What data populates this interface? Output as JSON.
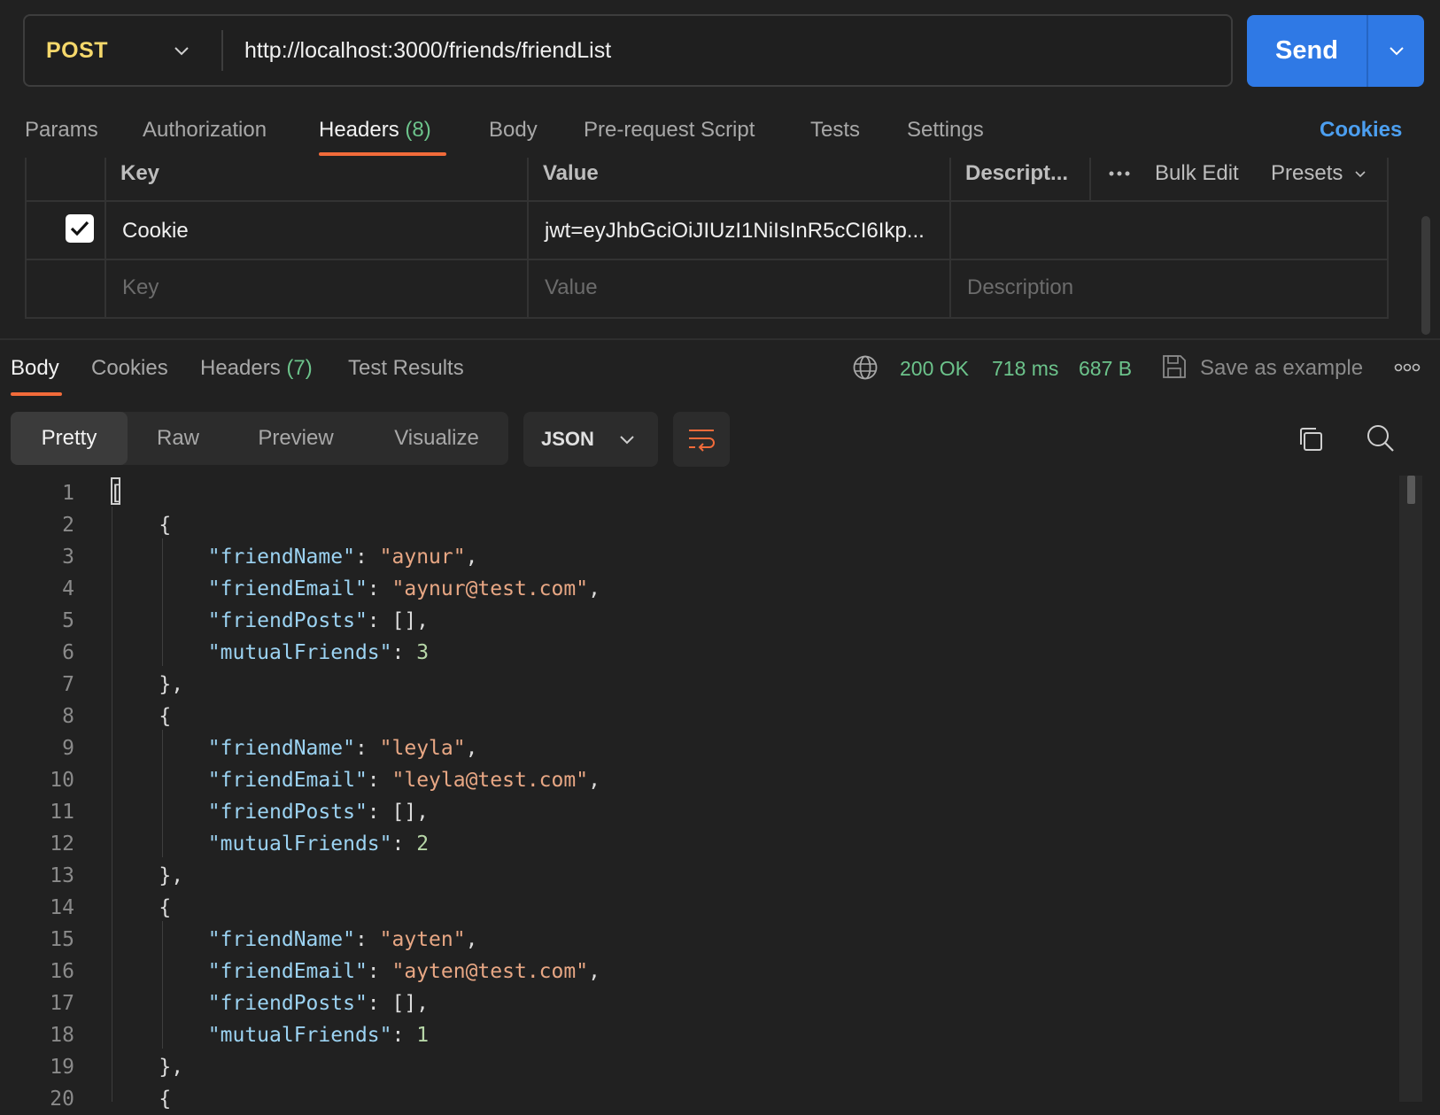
{
  "request": {
    "method": "POST",
    "url": "http://localhost:3000/friends/friendList",
    "send_label": "Send"
  },
  "request_tabs": [
    {
      "label": "Params"
    },
    {
      "label": "Authorization"
    },
    {
      "label": "Headers",
      "count": "(8)"
    },
    {
      "label": "Body"
    },
    {
      "label": "Pre-request Script"
    },
    {
      "label": "Tests"
    },
    {
      "label": "Settings"
    }
  ],
  "cookies_link": "Cookies",
  "headers_table": {
    "columns": {
      "key": "Key",
      "value": "Value",
      "description": "Descript..."
    },
    "actions": {
      "bulk_edit": "Bulk Edit",
      "presets": "Presets"
    },
    "rows": [
      {
        "checked": true,
        "key": "Cookie",
        "value": "jwt=eyJhbGciOiJIUzI1NiIsInR5cCI6Ikp..."
      }
    ],
    "placeholder": {
      "key": "Key",
      "value": "Value",
      "description": "Description"
    }
  },
  "response_tabs": [
    {
      "label": "Body"
    },
    {
      "label": "Cookies"
    },
    {
      "label": "Headers",
      "count": "(7)"
    },
    {
      "label": "Test Results"
    }
  ],
  "response_status": {
    "status": "200 OK",
    "time": "718 ms",
    "size": "687 B",
    "save_example": "Save as example"
  },
  "view_tabs": [
    "Pretty",
    "Raw",
    "Preview",
    "Visualize"
  ],
  "format": "JSON",
  "code_lines": [
    [
      [
        "p",
        "["
      ]
    ],
    [
      [
        "p",
        "    {"
      ]
    ],
    [
      [
        "p",
        "        "
      ],
      [
        "k",
        "\"friendName\""
      ],
      [
        "p",
        ": "
      ],
      [
        "s",
        "\"aynur\""
      ],
      [
        "p",
        ","
      ]
    ],
    [
      [
        "p",
        "        "
      ],
      [
        "k",
        "\"friendEmail\""
      ],
      [
        "p",
        ": "
      ],
      [
        "s",
        "\"aynur@test.com\""
      ],
      [
        "p",
        ","
      ]
    ],
    [
      [
        "p",
        "        "
      ],
      [
        "k",
        "\"friendPosts\""
      ],
      [
        "p",
        ": [],"
      ]
    ],
    [
      [
        "p",
        "        "
      ],
      [
        "k",
        "\"mutualFriends\""
      ],
      [
        "p",
        ": "
      ],
      [
        "n",
        "3"
      ]
    ],
    [
      [
        "p",
        "    },"
      ]
    ],
    [
      [
        "p",
        "    {"
      ]
    ],
    [
      [
        "p",
        "        "
      ],
      [
        "k",
        "\"friendName\""
      ],
      [
        "p",
        ": "
      ],
      [
        "s",
        "\"leyla\""
      ],
      [
        "p",
        ","
      ]
    ],
    [
      [
        "p",
        "        "
      ],
      [
        "k",
        "\"friendEmail\""
      ],
      [
        "p",
        ": "
      ],
      [
        "s",
        "\"leyla@test.com\""
      ],
      [
        "p",
        ","
      ]
    ],
    [
      [
        "p",
        "        "
      ],
      [
        "k",
        "\"friendPosts\""
      ],
      [
        "p",
        ": [],"
      ]
    ],
    [
      [
        "p",
        "        "
      ],
      [
        "k",
        "\"mutualFriends\""
      ],
      [
        "p",
        ": "
      ],
      [
        "n",
        "2"
      ]
    ],
    [
      [
        "p",
        "    },"
      ]
    ],
    [
      [
        "p",
        "    {"
      ]
    ],
    [
      [
        "p",
        "        "
      ],
      [
        "k",
        "\"friendName\""
      ],
      [
        "p",
        ": "
      ],
      [
        "s",
        "\"ayten\""
      ],
      [
        "p",
        ","
      ]
    ],
    [
      [
        "p",
        "        "
      ],
      [
        "k",
        "\"friendEmail\""
      ],
      [
        "p",
        ": "
      ],
      [
        "s",
        "\"ayten@test.com\""
      ],
      [
        "p",
        ","
      ]
    ],
    [
      [
        "p",
        "        "
      ],
      [
        "k",
        "\"friendPosts\""
      ],
      [
        "p",
        ": [],"
      ]
    ],
    [
      [
        "p",
        "        "
      ],
      [
        "k",
        "\"mutualFriends\""
      ],
      [
        "p",
        ": "
      ],
      [
        "n",
        "1"
      ]
    ],
    [
      [
        "p",
        "    },"
      ]
    ],
    [
      [
        "p",
        "    {"
      ]
    ]
  ]
}
